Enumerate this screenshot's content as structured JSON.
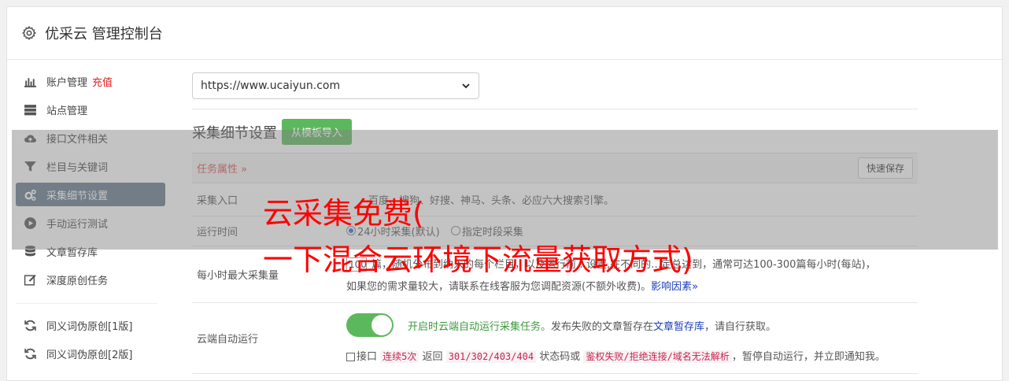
{
  "header": {
    "title": "优采云 管理控制台"
  },
  "sidebar": {
    "items": [
      {
        "label": "账户管理",
        "extra": "充值",
        "icon": "bar-chart-icon"
      },
      {
        "label": "站点管理",
        "icon": "server-icon"
      },
      {
        "label": "接口文件相关",
        "icon": "cloud-upload-icon"
      },
      {
        "label": "栏目与关键词",
        "icon": "filter-icon"
      },
      {
        "label": "采集细节设置",
        "icon": "gears-icon",
        "active": true
      },
      {
        "label": "手动运行测试",
        "icon": "play-circle-icon"
      },
      {
        "label": "文章暂存库",
        "icon": "database-icon"
      },
      {
        "label": "深度原创任务",
        "icon": "edit-icon"
      },
      {
        "label": "同义词伪原创[1版]",
        "icon": "refresh-icon"
      },
      {
        "label": "同义词伪原创[2版]",
        "icon": "refresh-icon"
      }
    ]
  },
  "main": {
    "site_select": {
      "value": "https://www.ucaiyun.com"
    },
    "section_title": "采集细节设置",
    "import_button": "从模板导入",
    "table": {
      "head_label": "任务属性 »",
      "save_button": "快速保存",
      "rows": {
        "entry": {
          "label": "采集入口",
          "text": "百度、搜狗、好搜、神马、头条、必应六大搜索引擎。"
        },
        "runtime": {
          "label": "运行时间",
          "opt1": "24小时采集(默认)",
          "opt2": "指定时段采集"
        },
        "max_rate": {
          "label": "每小时最大采集量",
          "num": "100",
          "line1a": "篇，随机分布到纳入的每个栏目，以及运行前…设置,在不同的…定总达到，",
          "line1b": "通常可达100-300篇每小时(每站)，",
          "line2": "如果您的需求量较大，请联系在线客服为您调配资源(不额外收费)。",
          "link": "影响因素»"
        },
        "cloud": {
          "label": "云端自动运行",
          "toggle_text": "开启时云端自动运行采集任务。",
          "desc1": "发布失败的文章暂存在",
          "desc_link": "文章暂存库",
          "desc2": "，请自行获取。",
          "chk_label": "接口",
          "code1": "连续5次",
          "t1": "返回",
          "code2": "301/302/403/404",
          "t2": "状态码或",
          "code3": "鉴权失败/拒绝连接/域名无法解析",
          "t3": "，暂停自动运行，并立即通知我。"
        }
      }
    }
  },
  "watermark": {
    "line1": "云采集免费(",
    "line2": "一下混合云环境下流量获取方式)"
  }
}
